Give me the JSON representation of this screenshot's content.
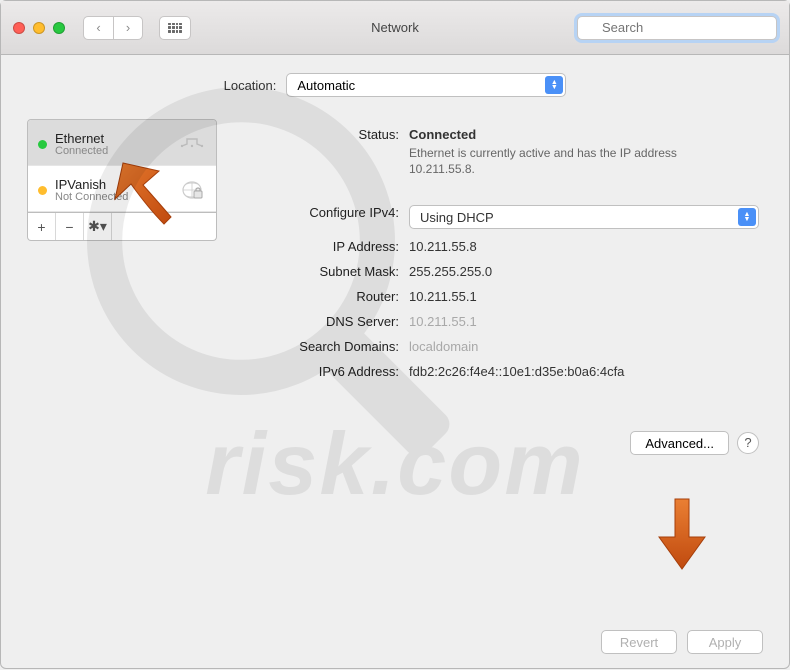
{
  "window": {
    "title": "Network",
    "search_placeholder": "Search"
  },
  "location": {
    "label": "Location:",
    "value": "Automatic"
  },
  "sidebar": {
    "items": [
      {
        "name": "Ethernet",
        "status": "Connected",
        "dot": "green",
        "selected": true,
        "icon": "ethernet"
      },
      {
        "name": "IPVanish",
        "status": "Not Connected",
        "dot": "amber",
        "selected": false,
        "icon": "vpn-lock"
      }
    ]
  },
  "detail": {
    "status_label": "Status:",
    "status_value": "Connected",
    "status_sub": "Ethernet is currently active and has the IP address 10.211.55.8.",
    "configure_label": "Configure IPv4:",
    "configure_value": "Using DHCP",
    "ip_label": "IP Address:",
    "ip_value": "10.211.55.8",
    "subnet_label": "Subnet Mask:",
    "subnet_value": "255.255.255.0",
    "router_label": "Router:",
    "router_value": "10.211.55.1",
    "dns_label": "DNS Server:",
    "dns_value": "10.211.55.1",
    "search_domains_label": "Search Domains:",
    "search_domains_value": "localdomain",
    "ipv6_label": "IPv6 Address:",
    "ipv6_value": "fdb2:2c26:f4e4::10e1:d35e:b0a6:4cfa",
    "advanced_label": "Advanced...",
    "help_label": "?"
  },
  "footer": {
    "revert": "Revert",
    "apply": "Apply"
  },
  "annotations": {
    "arrow_color": "#d65a18"
  }
}
